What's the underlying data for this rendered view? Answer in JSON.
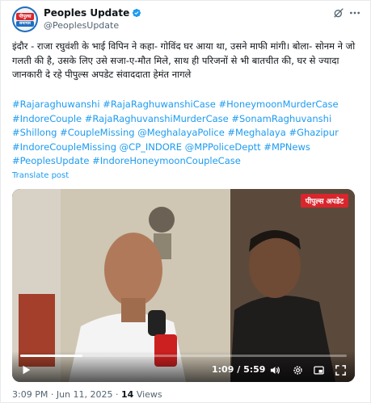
{
  "account": {
    "display_name": "Peoples Update",
    "handle": "@PeoplesUpdate",
    "avatar_top": "पीपुल्स",
    "avatar_bottom": "समाचार"
  },
  "tweet": {
    "text": "इंदौर - राजा रघुवंशी के भाई विपिन ने कहा- गोविंद घर आया था, उसने माफी मांगी। बोला- सोनम ने जो गलती की है, उसके लिए उसे सजा-ए-मौत मिले, साथ ही परिजनों से भी बातचीत की, घर से ज्यादा जानकारी दे रहे पीपुल्स अपडेट संवाददाता हेमंत नागले",
    "hashtags": "#Rajaraghuwanshi #RajaRaghuwanshiCase #HoneymoonMurderCase #IndoreCouple #RajaRaghuvanshiMurderCase #SonamRaghuvanshi #Shillong #CoupleMissing @MeghalayaPolice #Meghalaya #Ghazipur #IndoreCoupleMissing @CP_INDORE @MPPoliceDeptt #MPNews #PeoplesUpdate #IndoreHoneymoonCoupleCase",
    "translate_label": "Translate post"
  },
  "video": {
    "brand_label": "पीपुल्स अपडेट",
    "time_current": "1:09",
    "time_total": "5:59",
    "progress_fraction": 0.19
  },
  "meta": {
    "time": "3:09 PM",
    "date": "Jun 11, 2025",
    "views_count": "14",
    "views_label": "Views"
  },
  "colors": {
    "link": "#1d9bf0",
    "brand_red": "#d9262c",
    "brand_blue": "#1d6fc2"
  }
}
